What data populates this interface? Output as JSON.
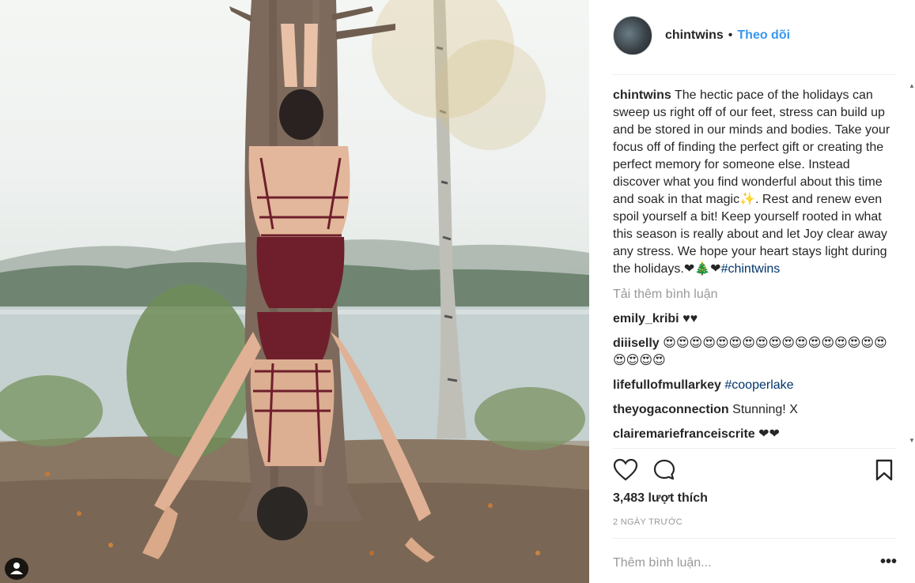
{
  "post": {
    "username": "chintwins",
    "separator": "•",
    "follow_label": "Theo dõi",
    "caption_text": "The hectic pace of the holidays can sweep us right off of our feet, stress can build up and be stored in our minds and bodies. Take your focus off of finding the perfect gift or creating the perfect memory for someone else. Instead discover what you find wonderful about this time and soak in that magic✨. Rest and renew even spoil yourself a bit! Keep yourself rooted in what this season is really about and let Joy clear away any stress. We hope your heart stays light during the holidays.",
    "caption_emojis": "❤🎄❤",
    "caption_hashtag": "#chintwins",
    "load_more_label": "Tải thêm bình luận",
    "comments": [
      {
        "user": "emily_kribi",
        "text": "♥♥",
        "link": ""
      },
      {
        "user": "diiiselly",
        "text": "😍😍😍😍😍😍😍😍😍😍😍😍😍😍😍😍😍😍😍😍😍",
        "link": ""
      },
      {
        "user": "lifefullofmullarkey",
        "text": "",
        "link": "#cooperlake"
      },
      {
        "user": "theyogaconnection",
        "text": "Stunning! X",
        "link": ""
      },
      {
        "user": "clairemariefranceiscrite",
        "text": "❤❤",
        "link": ""
      }
    ],
    "likes_label": "3,483 lượt thích",
    "time_label": "2 NGÀY TRƯỚC",
    "comment_placeholder": "Thêm bình luận...",
    "options_label": "•••",
    "icons": [
      "heart-icon",
      "comment-icon",
      "bookmark-icon",
      "user-tag-icon",
      "more-options-icon"
    ],
    "colors": {
      "link": "#3897f0",
      "hashtag": "#003569",
      "muted": "#999999",
      "text": "#262626"
    }
  }
}
